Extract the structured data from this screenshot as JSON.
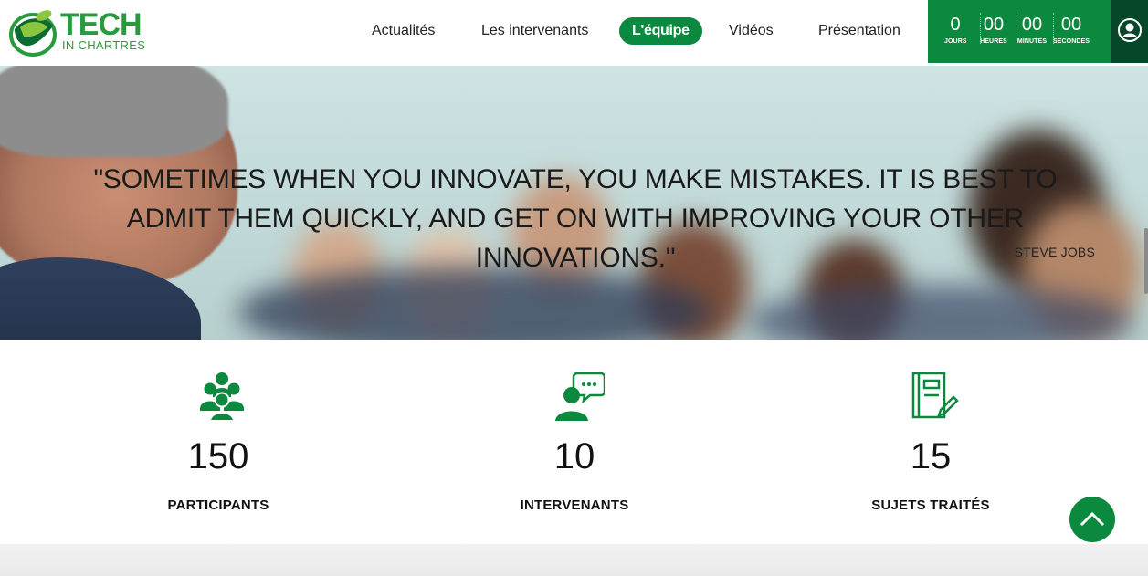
{
  "brand": {
    "name_line1": "TECH",
    "name_line2": "IN CHARTRES",
    "color": "#2a9a3e"
  },
  "nav": {
    "items": [
      {
        "label": "Actualités",
        "active": false
      },
      {
        "label": "Les intervenants",
        "active": false
      },
      {
        "label": "L'équipe",
        "active": true
      },
      {
        "label": "Vidéos",
        "active": false
      },
      {
        "label": "Présentation",
        "active": false
      }
    ],
    "active_color": "#0b8a3f"
  },
  "countdown": {
    "days": {
      "value": "0",
      "label": "JOURS"
    },
    "hours": {
      "value": "00",
      "label": "HEURES"
    },
    "minutes": {
      "value": "00",
      "label": "MINUTES"
    },
    "seconds": {
      "value": "00",
      "label": "SECONDES"
    }
  },
  "user": {
    "icon": "user-icon"
  },
  "hero": {
    "quote": "\"SOMETIMES WHEN YOU INNOVATE, YOU MAKE MISTAKES. IT IS BEST TO ADMIT THEM QUICKLY, AND GET ON WITH IMPROVING YOUR OTHER INNOVATIONS.\"",
    "author": "STEVE JOBS"
  },
  "stats": [
    {
      "icon": "group-icon",
      "value": "150",
      "label": "PARTICIPANTS"
    },
    {
      "icon": "speaker-icon",
      "value": "10",
      "label": "INTERVENANTS"
    },
    {
      "icon": "notebook-pen-icon",
      "value": "15",
      "label": "SUJETS TRAITÉS"
    }
  ],
  "back_to_top": {
    "icon": "chevron-up-icon"
  }
}
